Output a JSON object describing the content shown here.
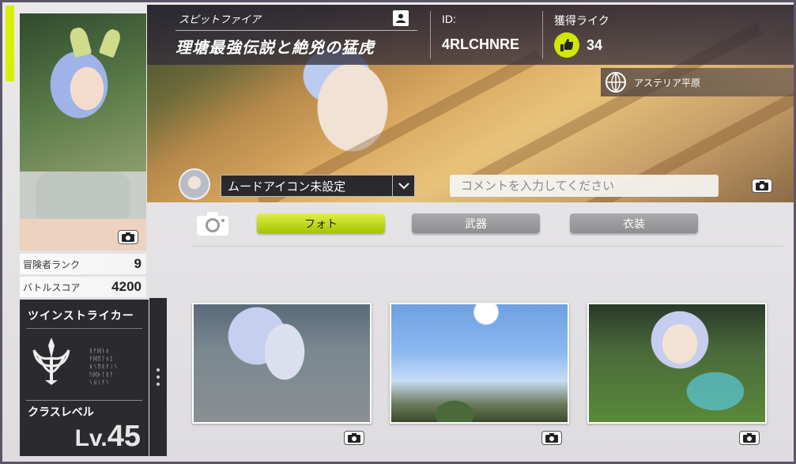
{
  "profile": {
    "class_subtitle": "スピットファイア",
    "title": "理塘最強伝説と絶兇の猛虎",
    "id_label": "ID:",
    "id_value": "4RLCHNRE",
    "likes_label": "獲得ライク",
    "likes_count": "34",
    "location": "アステリア平原"
  },
  "stats": {
    "rank_label": "冒険者ランク",
    "rank_value": "9",
    "score_label": "バトルスコア",
    "score_value": "4200"
  },
  "class_card": {
    "class_name": "ツインストライカー",
    "level_label": "クラスレベル",
    "level_prefix": "Lv.",
    "level_value": "45"
  },
  "mood": {
    "selected": "ムードアイコン未設定"
  },
  "comment": {
    "placeholder": "コメントを入力してください"
  },
  "tabs": [
    {
      "label": "フォト",
      "active": true
    },
    {
      "label": "武器",
      "active": false
    },
    {
      "label": "衣装",
      "active": false
    }
  ],
  "photos": [
    {
      "subject": "character-closeup"
    },
    {
      "subject": "sky-landscape"
    },
    {
      "subject": "character-winged"
    }
  ],
  "colors": {
    "accent": "#d8f000",
    "tab_active": "#b5d200",
    "tab_inactive": "#9a9a9c",
    "panel_dark": "#2b2b2f"
  },
  "icons": [
    "camera-icon",
    "profile-icon",
    "like-icon",
    "globe-icon",
    "chevron-down-icon",
    "class-emblem-icon",
    "more-dots-icon"
  ]
}
